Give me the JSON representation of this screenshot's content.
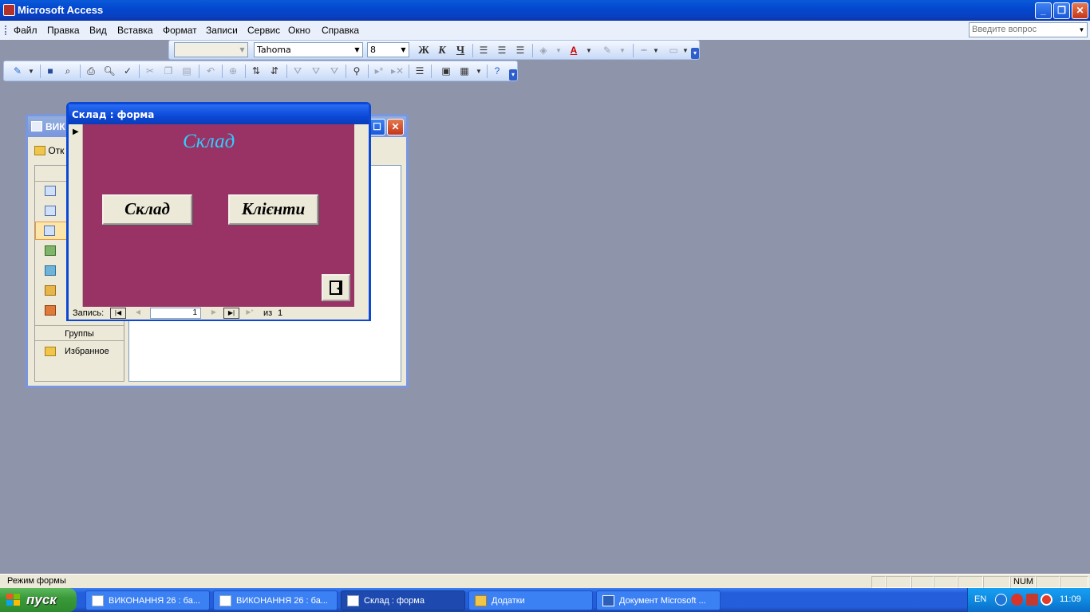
{
  "app": {
    "title": "Microsoft Access"
  },
  "menu": [
    "Файл",
    "Правка",
    "Вид",
    "Вставка",
    "Формат",
    "Записи",
    "Сервис",
    "Окно",
    "Справка"
  ],
  "help_box": {
    "placeholder": "Введите вопрос"
  },
  "format_toolbar": {
    "object_combo": "",
    "font_name": "Tahoma",
    "font_size": "8",
    "bold": "Ж",
    "italic": "К",
    "underline": "Ч"
  },
  "db_window": {
    "title": "ВИК",
    "open_label": "Отк",
    "objects_header": "О",
    "groups_header": "Группы",
    "favorites": "Избранное"
  },
  "form_window": {
    "title": "Склад : форма",
    "heading": "Склад",
    "buttons": [
      "Склад",
      "Клієнти"
    ],
    "nav": {
      "label": "Запись:",
      "current": "1",
      "of_label": "из",
      "total": "1"
    }
  },
  "status": {
    "mode": "Режим формы",
    "num": "NUM"
  },
  "taskbar": {
    "start": "пуск",
    "tasks": [
      "ВИКОНАННЯ 26 : ба...",
      "ВИКОНАННЯ 26 : ба...",
      "Склад : форма",
      "Додатки",
      "Документ Microsoft ..."
    ],
    "lang": "EN",
    "clock": "11:09"
  }
}
